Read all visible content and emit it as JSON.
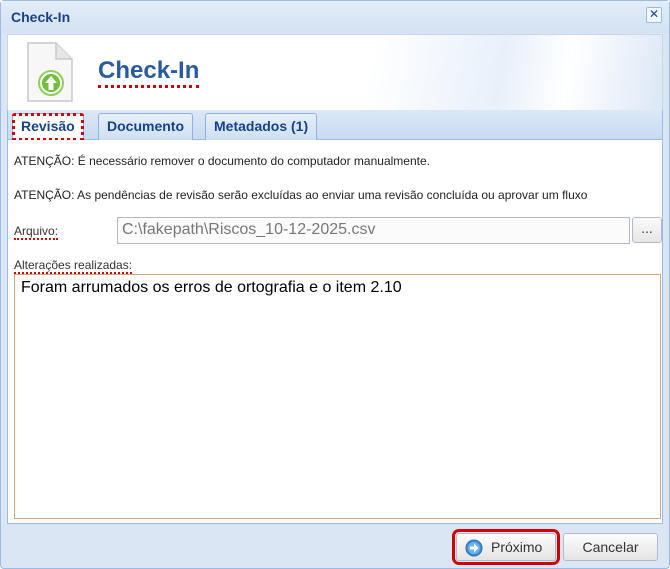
{
  "window": {
    "title": "Check-In",
    "close_symbol": "✕"
  },
  "header": {
    "title": "Check-In",
    "icon": "document-upload-icon"
  },
  "tabs": [
    {
      "label": "Revisão",
      "active": true
    },
    {
      "label": "Documento",
      "active": false
    },
    {
      "label": "Metadados (1)",
      "active": false
    }
  ],
  "content": {
    "warning_1": "ATENÇÃO: É necessário remover o documento do computador manualmente.",
    "warning_2": "ATENÇÃO: As pendências de revisão serão excluídas ao enviar uma revisão concluída ou aprovar um fluxo",
    "file_label": "Arquivo:",
    "file_value": "C:\\fakepath\\Riscos_10-12-2025.csv",
    "browse_label": "...",
    "changes_label": "Alterações realizadas:",
    "changes_value": "Foram arrumados os erros de ortografia e o item 2.10"
  },
  "footer": {
    "next_label": "Próximo",
    "cancel_label": "Cancelar"
  },
  "colors": {
    "title_text": "#15428b",
    "header_title": "#2a5aa0",
    "highlight": "#d00000",
    "panel_border": "#99bbe8"
  }
}
